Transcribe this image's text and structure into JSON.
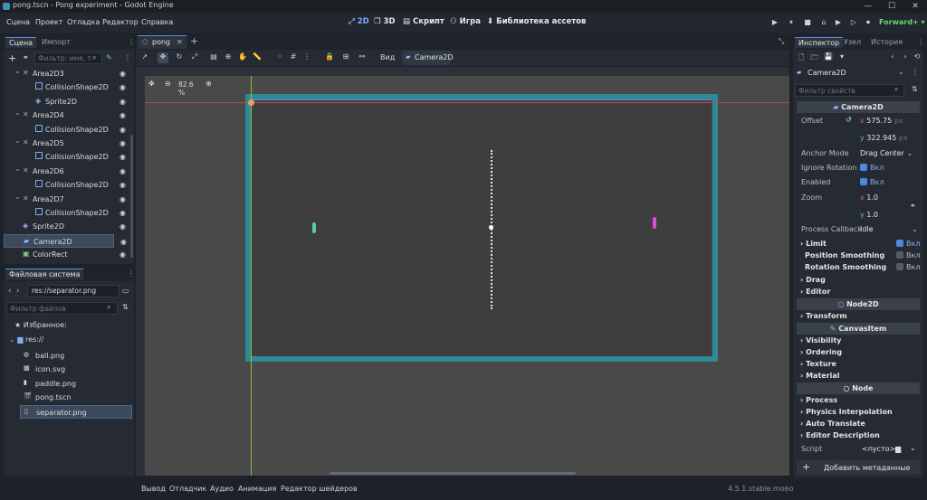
{
  "window": {
    "title": "pong.tscn - Pong experiment - Godot Engine",
    "controls": [
      "—",
      "☐",
      "✕"
    ]
  },
  "menu": [
    "Сцена",
    "Проект",
    "Отладка",
    "Редактор",
    "Справка"
  ],
  "workspaces": {
    "w2d": "2D",
    "w3d": "3D",
    "script": "Скрипт",
    "game": "Игра",
    "assetlib": "Библиотека ассетов"
  },
  "renderer": "Forward+",
  "scene_dock": {
    "tabs": [
      "Сцена",
      "Импорт"
    ],
    "filter_placeholder": "Фильтр: имя, т",
    "nodes": [
      {
        "label": "Area2D3",
        "kind": "area",
        "indent": 1
      },
      {
        "label": "CollisionShape2D",
        "kind": "shape",
        "indent": 2
      },
      {
        "label": "Sprite2D",
        "kind": "sprite",
        "indent": 2
      },
      {
        "label": "Area2D4",
        "kind": "area",
        "indent": 1
      },
      {
        "label": "CollisionShape2D",
        "kind": "shape",
        "indent": 2
      },
      {
        "label": "Area2D5",
        "kind": "area",
        "indent": 1
      },
      {
        "label": "CollisionShape2D",
        "kind": "shape",
        "indent": 2
      },
      {
        "label": "Area2D6",
        "kind": "area",
        "indent": 1
      },
      {
        "label": "CollisionShape2D",
        "kind": "shape",
        "indent": 2
      },
      {
        "label": "Area2D7",
        "kind": "area",
        "indent": 1
      },
      {
        "label": "CollisionShape2D",
        "kind": "shape",
        "indent": 2
      },
      {
        "label": "Sprite2D",
        "kind": "sprite",
        "indent": 1
      },
      {
        "label": "Camera2D",
        "kind": "camera",
        "indent": 1
      },
      {
        "label": "ColorRect",
        "kind": "colorrect",
        "indent": 1
      }
    ]
  },
  "filesystem": {
    "title": "Файловая система",
    "path": "res://separator.png",
    "filter_placeholder": "Фильтр файлов",
    "favorites": "Избранное:",
    "root": "res://",
    "files": [
      "ball.png",
      "icon.svg",
      "paddle.png",
      "pong.tscn",
      "separator.png"
    ]
  },
  "editor": {
    "tab": "pong",
    "view_menu": "Вид",
    "camera_btn": "Camera2D",
    "zoom": "82.6 %"
  },
  "bottom_panel": {
    "tabs": [
      "Вывод",
      "Отладчик",
      "Аудио",
      "Анимация",
      "Редактор шейдеров"
    ],
    "version": "4.5.1.stable.mono"
  },
  "inspector": {
    "tabs": [
      "Инспектор",
      "Узел",
      "История"
    ],
    "object": "Camera2D",
    "filter_placeholder": "Фильтр свойств",
    "class_header": "Camera2D",
    "offset_label": "Offset",
    "offset_x": "575.75",
    "offset_y": "322.945",
    "unit_px": "px",
    "anchor_label": "Anchor Mode",
    "anchor_value": "Drag Center",
    "ignore_rotation_label": "Ignore Rotation",
    "enabled_label": "Enabled",
    "on_label": "Вкл",
    "zoom_label": "Zoom",
    "zoom_x": "1.0",
    "zoom_y": "1.0",
    "process_callback_label": "Process Callback",
    "process_callback_value": "Idle",
    "limit": "Limit",
    "position_smoothing": "Position Smoothing",
    "rotation_smoothing": "Rotation Smoothing",
    "drag": "Drag",
    "editor": "Editor",
    "node2d_header": "Node2D",
    "transform": "Transform",
    "canvasitem_header": "CanvasItem",
    "visibility": "Visibility",
    "ordering": "Ordering",
    "texture": "Texture",
    "material": "Material",
    "node_header": "Node",
    "process": "Process",
    "physics_interp": "Physics Interpolation",
    "auto_translate": "Auto Translate",
    "editor_desc": "Editor Description",
    "script_label": "Script",
    "script_value": "<пусто>",
    "add_metadata": "Добавить метаданные"
  },
  "colors": {
    "accent": "#78a8ff",
    "viewport_bg": "#4a4a4a",
    "camera_frame": "#2e8a97",
    "selected_row": "#3c4a5b"
  }
}
